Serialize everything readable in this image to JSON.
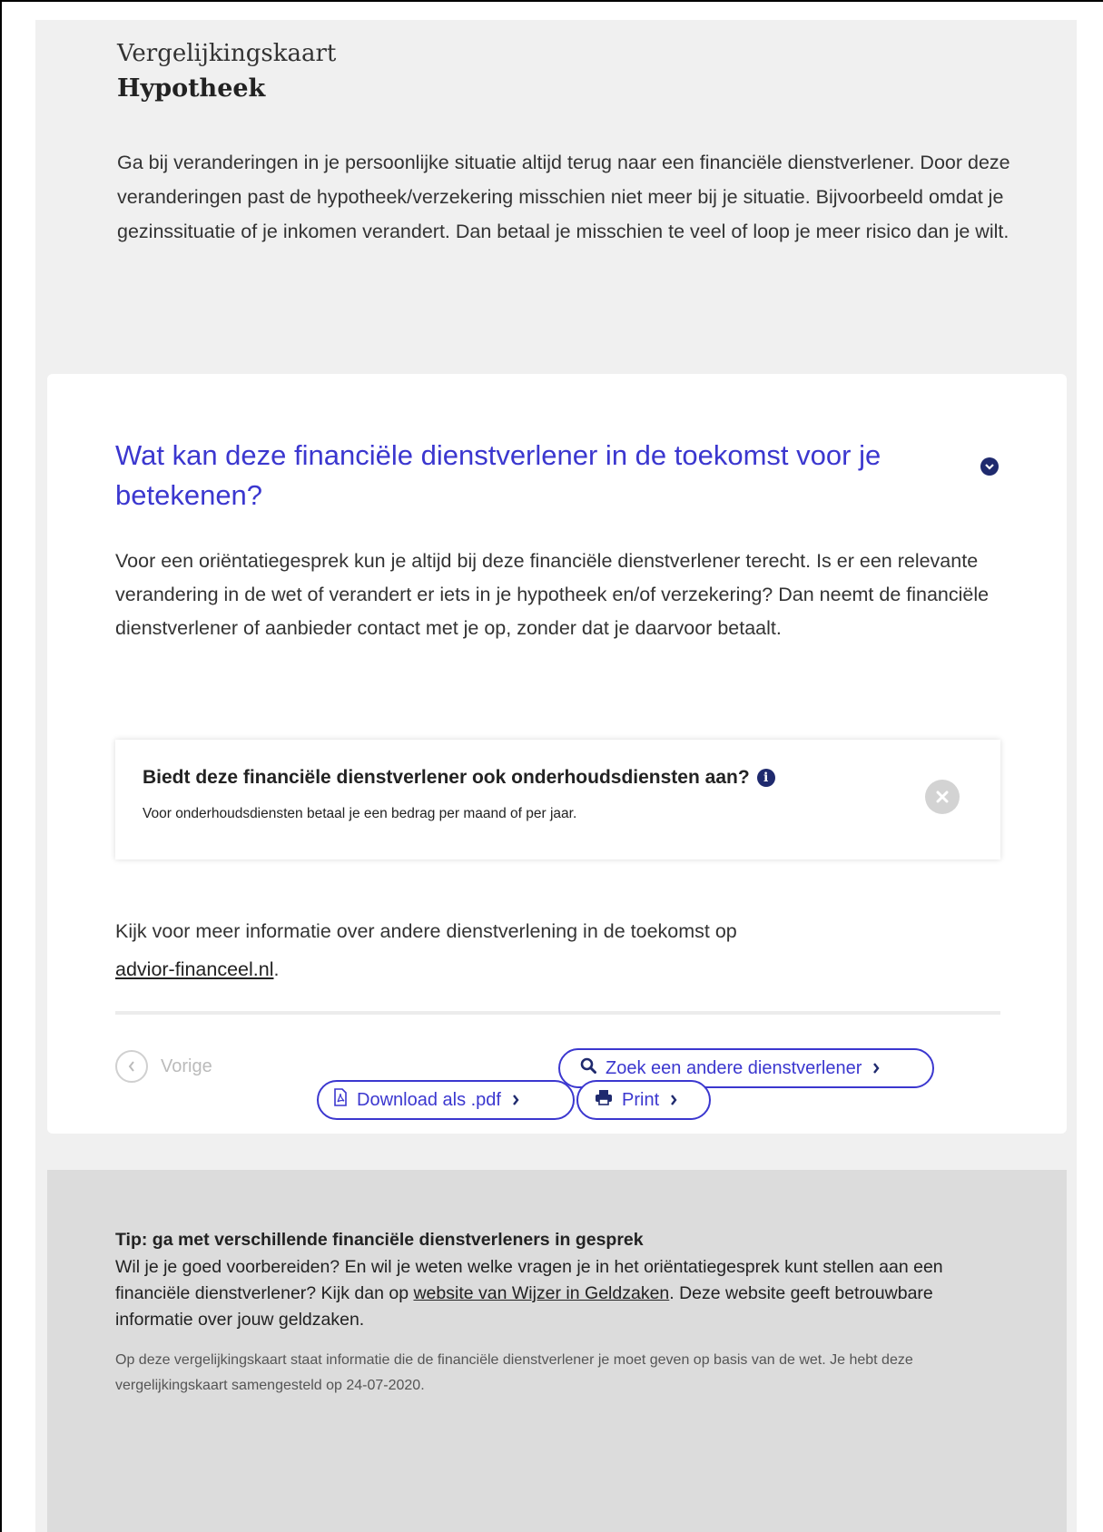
{
  "header": {
    "kicker": "Vergelijkingskaart",
    "title": "Hypotheek"
  },
  "intro": "Ga bij veranderingen in je persoonlijke situatie altijd terug naar een financiële dienstverlener. Door deze veranderingen past de hypotheek/verzekering misschien niet meer bij je situatie. Bijvoorbeeld omdat je gezinssituatie of je inkomen verandert. Dan betaal je misschien te veel of loop je meer risico dan je wilt.",
  "section": {
    "heading": "Wat kan deze financiële dienstverlener in de toekomst voor je betekenen?",
    "toggle_icon": "chevron-down-icon",
    "paragraph": "Voor een oriëntatiegesprek kun je altijd bij deze financiële dienstverlener terecht. Is er een relevante verandering in de wet of verandert er iets in je hypotheek en/of verzekering? Dan neemt de financiële dienstverlener of aanbieder contact met je op, zonder dat je daarvoor betaalt.",
    "maintenance": {
      "question": "Biedt deze financiële dienstverlener ook onderhoudsdiensten aan?",
      "subtext": "Voor onderhoudsdiensten betaal je een bedrag per maand of per jaar.",
      "info_icon": "info-icon",
      "status_icon": "close-icon"
    },
    "more_info_prefix": "Kijk voor meer informatie over andere dienstverlening in de toekomst op",
    "more_info_link": "advior-financeel.nl",
    "more_info_suffix": "."
  },
  "nav": {
    "prev_label": "Vorige",
    "search_label": "Zoek een andere dienstverlener"
  },
  "actions": {
    "download_label": "Download als .pdf",
    "print_label": "Print"
  },
  "tip": {
    "heading": "Tip: ga met verschillende financiële dienstverleners in gesprek",
    "text_before": "Wil je je goed voorbereiden? En wil je weten welke vragen je in het oriëntatiegesprek kunt stellen aan een financiële dienstverlener? Kijk dan op",
    "link": "website van Wijzer in Geldzaken",
    "text_after": ". Deze website geeft betrouwbare informatie over jouw geldzaken.",
    "small_print": "Op deze vergelijkingskaart staat informatie die de financiële dienstverlener je moet geven op basis van de wet. Je hebt deze vergelijkingskaart samengesteld op 24-07-2020."
  },
  "colors": {
    "accent": "#3b37cf",
    "icon_dark": "#1f2a6e",
    "page_bg": "#f0f0f0",
    "tip_bg": "#dcdcdc"
  }
}
